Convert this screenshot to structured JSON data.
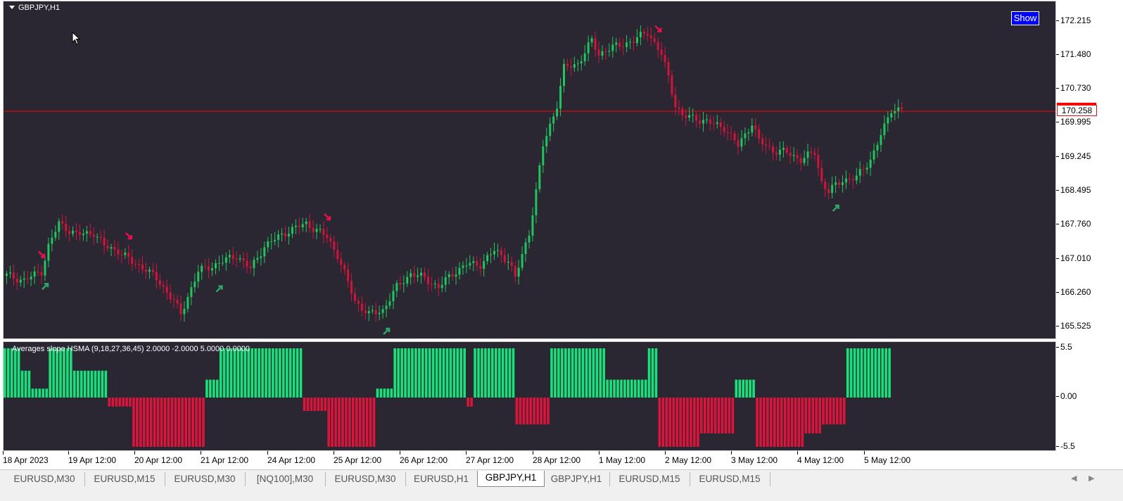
{
  "chart": {
    "title": "GBPJPY,H1",
    "show_button": "Show",
    "current_price": "170.258",
    "price_ticks": [
      "172.215",
      "171.480",
      "170.730",
      "169.995",
      "169.245",
      "168.495",
      "167.760",
      "167.010",
      "166.260",
      "165.525"
    ],
    "time_labels": [
      "18 Apr 2023",
      "19 Apr 12:00",
      "20 Apr 12:00",
      "21 Apr 12:00",
      "24 Apr 12:00",
      "25 Apr 12:00",
      "26 Apr 12:00",
      "27 Apr 12:00",
      "28 Apr 12:00",
      "1 May 12:00",
      "2 May 12:00",
      "3 May 12:00",
      "4 May 12:00",
      "5 May 12:00"
    ],
    "colors": {
      "background": "#2a2733",
      "bull": "#22c45e",
      "bear": "#d0143c",
      "price_line": "#ff0000"
    }
  },
  "indicator": {
    "label": "Averages slope HSMA (9,18,27,36,45) 2.0000 -2.0000 5.0000 0.0000",
    "ticks": [
      "5.5",
      "0.00",
      "-5.5"
    ],
    "colors": {
      "positive": "#19e07a",
      "negative": "#dc143c"
    }
  },
  "tabs": [
    {
      "label": "EURUSD,M30"
    },
    {
      "label": "EURUSD,M15"
    },
    {
      "label": "EURUSD,M30"
    },
    {
      "label": "[NQ100],M30"
    },
    {
      "label": "EURUSD,M30"
    },
    {
      "label": "EURUSD,H1"
    },
    {
      "label": "GBPJPY,H1",
      "active": true
    },
    {
      "label": "GBPJPY,H1"
    },
    {
      "label": "EURUSD,M15"
    },
    {
      "label": "EURUSD,M15"
    }
  ],
  "tab_nav": {
    "left": "◀",
    "right": "▶"
  },
  "chart_data": {
    "type": "candlestick",
    "symbol": "GBPJPY",
    "timeframe": "H1",
    "ylim": [
      165.3,
      172.5
    ],
    "close_path": [
      [
        0,
        166.66
      ],
      [
        5,
        166.55
      ],
      [
        10,
        166.75
      ],
      [
        12,
        167.3
      ],
      [
        15,
        167.8
      ],
      [
        20,
        167.55
      ],
      [
        25,
        167.6
      ],
      [
        28,
        167.3
      ],
      [
        32,
        167.2
      ],
      [
        36,
        166.95
      ],
      [
        40,
        166.8
      ],
      [
        44,
        166.5
      ],
      [
        48,
        166.1
      ],
      [
        50,
        165.8
      ],
      [
        52,
        166.2
      ],
      [
        55,
        166.75
      ],
      [
        60,
        166.9
      ],
      [
        66,
        167.1
      ],
      [
        70,
        166.8
      ],
      [
        74,
        167.3
      ],
      [
        80,
        167.6
      ],
      [
        86,
        167.8
      ],
      [
        92,
        167.5
      ],
      [
        95,
        167.1
      ],
      [
        98,
        166.5
      ],
      [
        100,
        166.1
      ],
      [
        104,
        165.8
      ],
      [
        108,
        165.9
      ],
      [
        112,
        166.4
      ],
      [
        116,
        166.7
      ],
      [
        120,
        166.6
      ],
      [
        124,
        166.4
      ],
      [
        128,
        166.7
      ],
      [
        132,
        166.9
      ],
      [
        136,
        166.9
      ],
      [
        140,
        167.2
      ],
      [
        144,
        167.0
      ],
      [
        146,
        166.6
      ],
      [
        150,
        167.6
      ],
      [
        152,
        168.5
      ],
      [
        154,
        169.5
      ],
      [
        158,
        170.4
      ],
      [
        160,
        171.2
      ],
      [
        164,
        171.3
      ],
      [
        168,
        171.8
      ],
      [
        170,
        171.5
      ],
      [
        172,
        171.6
      ],
      [
        176,
        171.7
      ],
      [
        180,
        171.8
      ],
      [
        184,
        172.0
      ],
      [
        188,
        171.5
      ],
      [
        190,
        171.0
      ],
      [
        192,
        170.4
      ],
      [
        194,
        170.15
      ],
      [
        198,
        170.1
      ],
      [
        202,
        170.0
      ],
      [
        206,
        169.9
      ],
      [
        210,
        169.5
      ],
      [
        214,
        170.0
      ],
      [
        216,
        169.6
      ],
      [
        220,
        169.4
      ],
      [
        224,
        169.35
      ],
      [
        228,
        169.2
      ],
      [
        232,
        169.35
      ],
      [
        234,
        168.7
      ],
      [
        236,
        168.5
      ],
      [
        240,
        168.75
      ],
      [
        244,
        168.8
      ],
      [
        248,
        169.2
      ],
      [
        252,
        169.9
      ],
      [
        254,
        170.3
      ],
      [
        257,
        170.3
      ]
    ],
    "signals": {
      "buy_bars": [
        11,
        61,
        109,
        238
      ],
      "sell_bars": [
        10,
        35,
        92,
        187
      ]
    },
    "indicator_hist": {
      "ylim": [
        -5.5,
        5.5
      ],
      "segments": [
        [
          0,
          5,
          5.5
        ],
        [
          5,
          8,
          3
        ],
        [
          8,
          13,
          1
        ],
        [
          13,
          20,
          5.5
        ],
        [
          20,
          30,
          3
        ],
        [
          30,
          37,
          -1
        ],
        [
          37,
          58,
          -5.5
        ],
        [
          58,
          62,
          2
        ],
        [
          62,
          86,
          5.5
        ],
        [
          86,
          93,
          -1.5
        ],
        [
          93,
          107,
          -5.5
        ],
        [
          107,
          112,
          1
        ],
        [
          112,
          133,
          5.5
        ],
        [
          133,
          135,
          -1
        ],
        [
          135,
          147,
          5.5
        ],
        [
          147,
          157,
          -3
        ],
        [
          157,
          173,
          5.5
        ],
        [
          173,
          185,
          2
        ],
        [
          185,
          188,
          5.5
        ],
        [
          188,
          200,
          -5.5
        ],
        [
          200,
          210,
          -4
        ],
        [
          210,
          216,
          2
        ],
        [
          216,
          230,
          -5.5
        ],
        [
          230,
          235,
          -4
        ],
        [
          235,
          242,
          -3
        ],
        [
          242,
          255,
          5.5
        ]
      ]
    }
  }
}
